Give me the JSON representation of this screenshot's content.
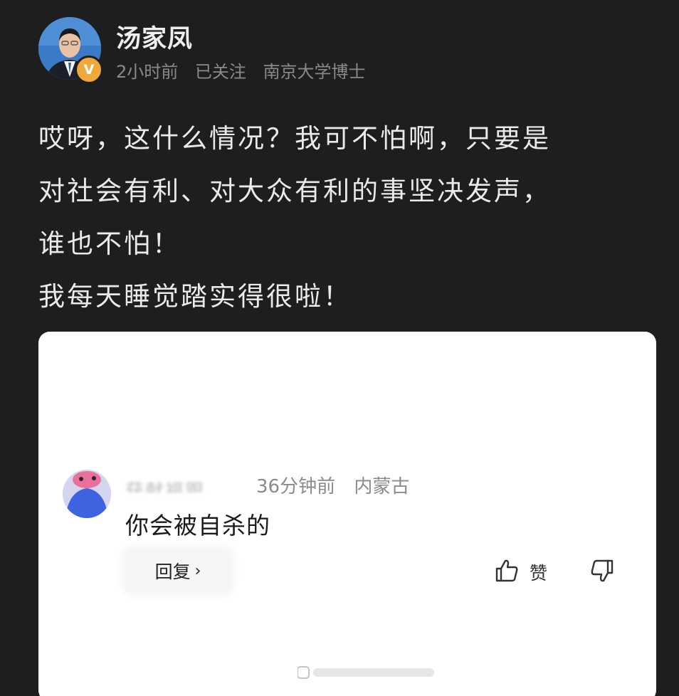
{
  "post": {
    "author": "汤家凤",
    "verify_badge": "V",
    "time": "2小时前",
    "follow_status": "已关注",
    "title": "南京大学博士",
    "lines": [
      "哎呀，这什么情况？我可不怕啊，只要是",
      "对社会有利、对大众有利的事坚决发声，",
      "谁也不怕！",
      "我每天睡觉踏实得很啦！"
    ]
  },
  "comment": {
    "username": "获献福跟",
    "time": "36分钟前",
    "location": "内蒙古",
    "text": "你会被自杀的",
    "reply_label": "回复",
    "like_label": "赞"
  },
  "colors": {
    "background": "#1e1e20",
    "badge": "#f0a83a",
    "card": "#ffffff"
  }
}
